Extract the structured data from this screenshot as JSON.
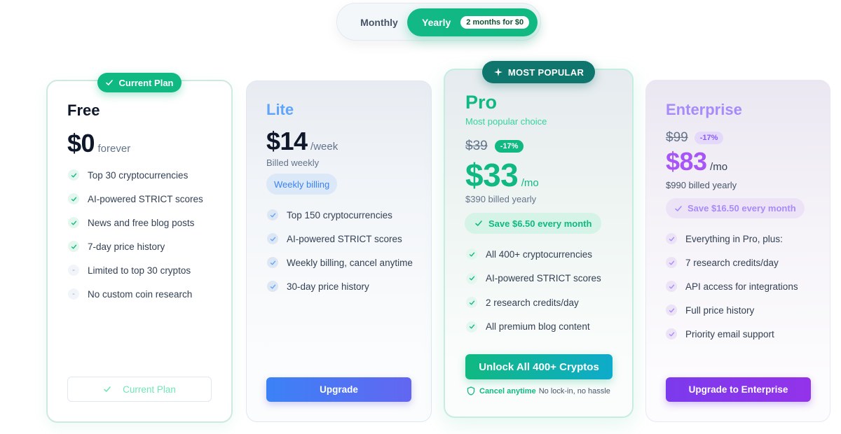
{
  "billing_toggle": {
    "monthly_label": "Monthly",
    "yearly_label": "Yearly",
    "yearly_badge": "2 months for $0"
  },
  "colors": {
    "accent_green": "#10b981",
    "lite_blue": "#3b82f6",
    "enterprise_purple": "#7c3aed",
    "popular_teal": "#0f766e"
  },
  "plans": {
    "free": {
      "badge": "Current Plan",
      "name": "Free",
      "price": "$0",
      "period": "forever",
      "features": [
        {
          "text": "Top 30 cryptocurrencies",
          "icon": "check-icon"
        },
        {
          "text": "AI-powered STRICT scores",
          "icon": "check-icon"
        },
        {
          "text": "News and free blog posts",
          "icon": "check-icon"
        },
        {
          "text": "7-day price history",
          "icon": "check-icon"
        },
        {
          "text": "Limited to top 30 cryptos",
          "icon": "dash-icon"
        },
        {
          "text": "No custom coin research",
          "icon": "dash-icon"
        }
      ],
      "button": "Current Plan"
    },
    "lite": {
      "name": "Lite",
      "price": "$14",
      "period": "/week",
      "billing_note": "Billed weekly",
      "chip": "Weekly billing",
      "features": [
        {
          "text": "Top 150 cryptocurrencies",
          "icon": "check-icon"
        },
        {
          "text": "AI-powered STRICT scores",
          "icon": "check-icon"
        },
        {
          "text": "Weekly billing, cancel anytime",
          "icon": "check-icon"
        },
        {
          "text": "30-day price history",
          "icon": "check-icon"
        }
      ],
      "button": "Upgrade"
    },
    "pro": {
      "badge": "MOST POPULAR",
      "name": "Pro",
      "tagline": "Most popular choice",
      "old_price": "$39",
      "discount": "-17%",
      "price": "$33",
      "period": "/mo",
      "billing_note": "$390 billed yearly",
      "savings": "Save $6.50 every month",
      "features": [
        {
          "text": "All 400+ cryptocurrencies",
          "icon": "check-icon"
        },
        {
          "text": "AI-powered STRICT scores",
          "icon": "check-icon"
        },
        {
          "text": "2 research credits/day",
          "icon": "check-icon"
        },
        {
          "text": "All premium blog content",
          "icon": "check-icon"
        }
      ],
      "button": "Unlock All 400+ Cryptos",
      "cancel_label": "Cancel anytime",
      "cancel_note": "No lock-in, no hassle"
    },
    "enterprise": {
      "name": "Enterprise",
      "old_price": "$99",
      "discount": "-17%",
      "price": "$83",
      "period": "/mo",
      "billing_note": "$990 billed yearly",
      "savings": "Save $16.50 every month",
      "features": [
        {
          "text": "Everything in Pro, plus:",
          "icon": "check-icon"
        },
        {
          "text": "7 research credits/day",
          "icon": "check-icon"
        },
        {
          "text": "API access for integrations",
          "icon": "check-icon"
        },
        {
          "text": "Full price history",
          "icon": "check-icon"
        },
        {
          "text": "Priority email support",
          "icon": "check-icon"
        }
      ],
      "button": "Upgrade to Enterprise"
    }
  }
}
